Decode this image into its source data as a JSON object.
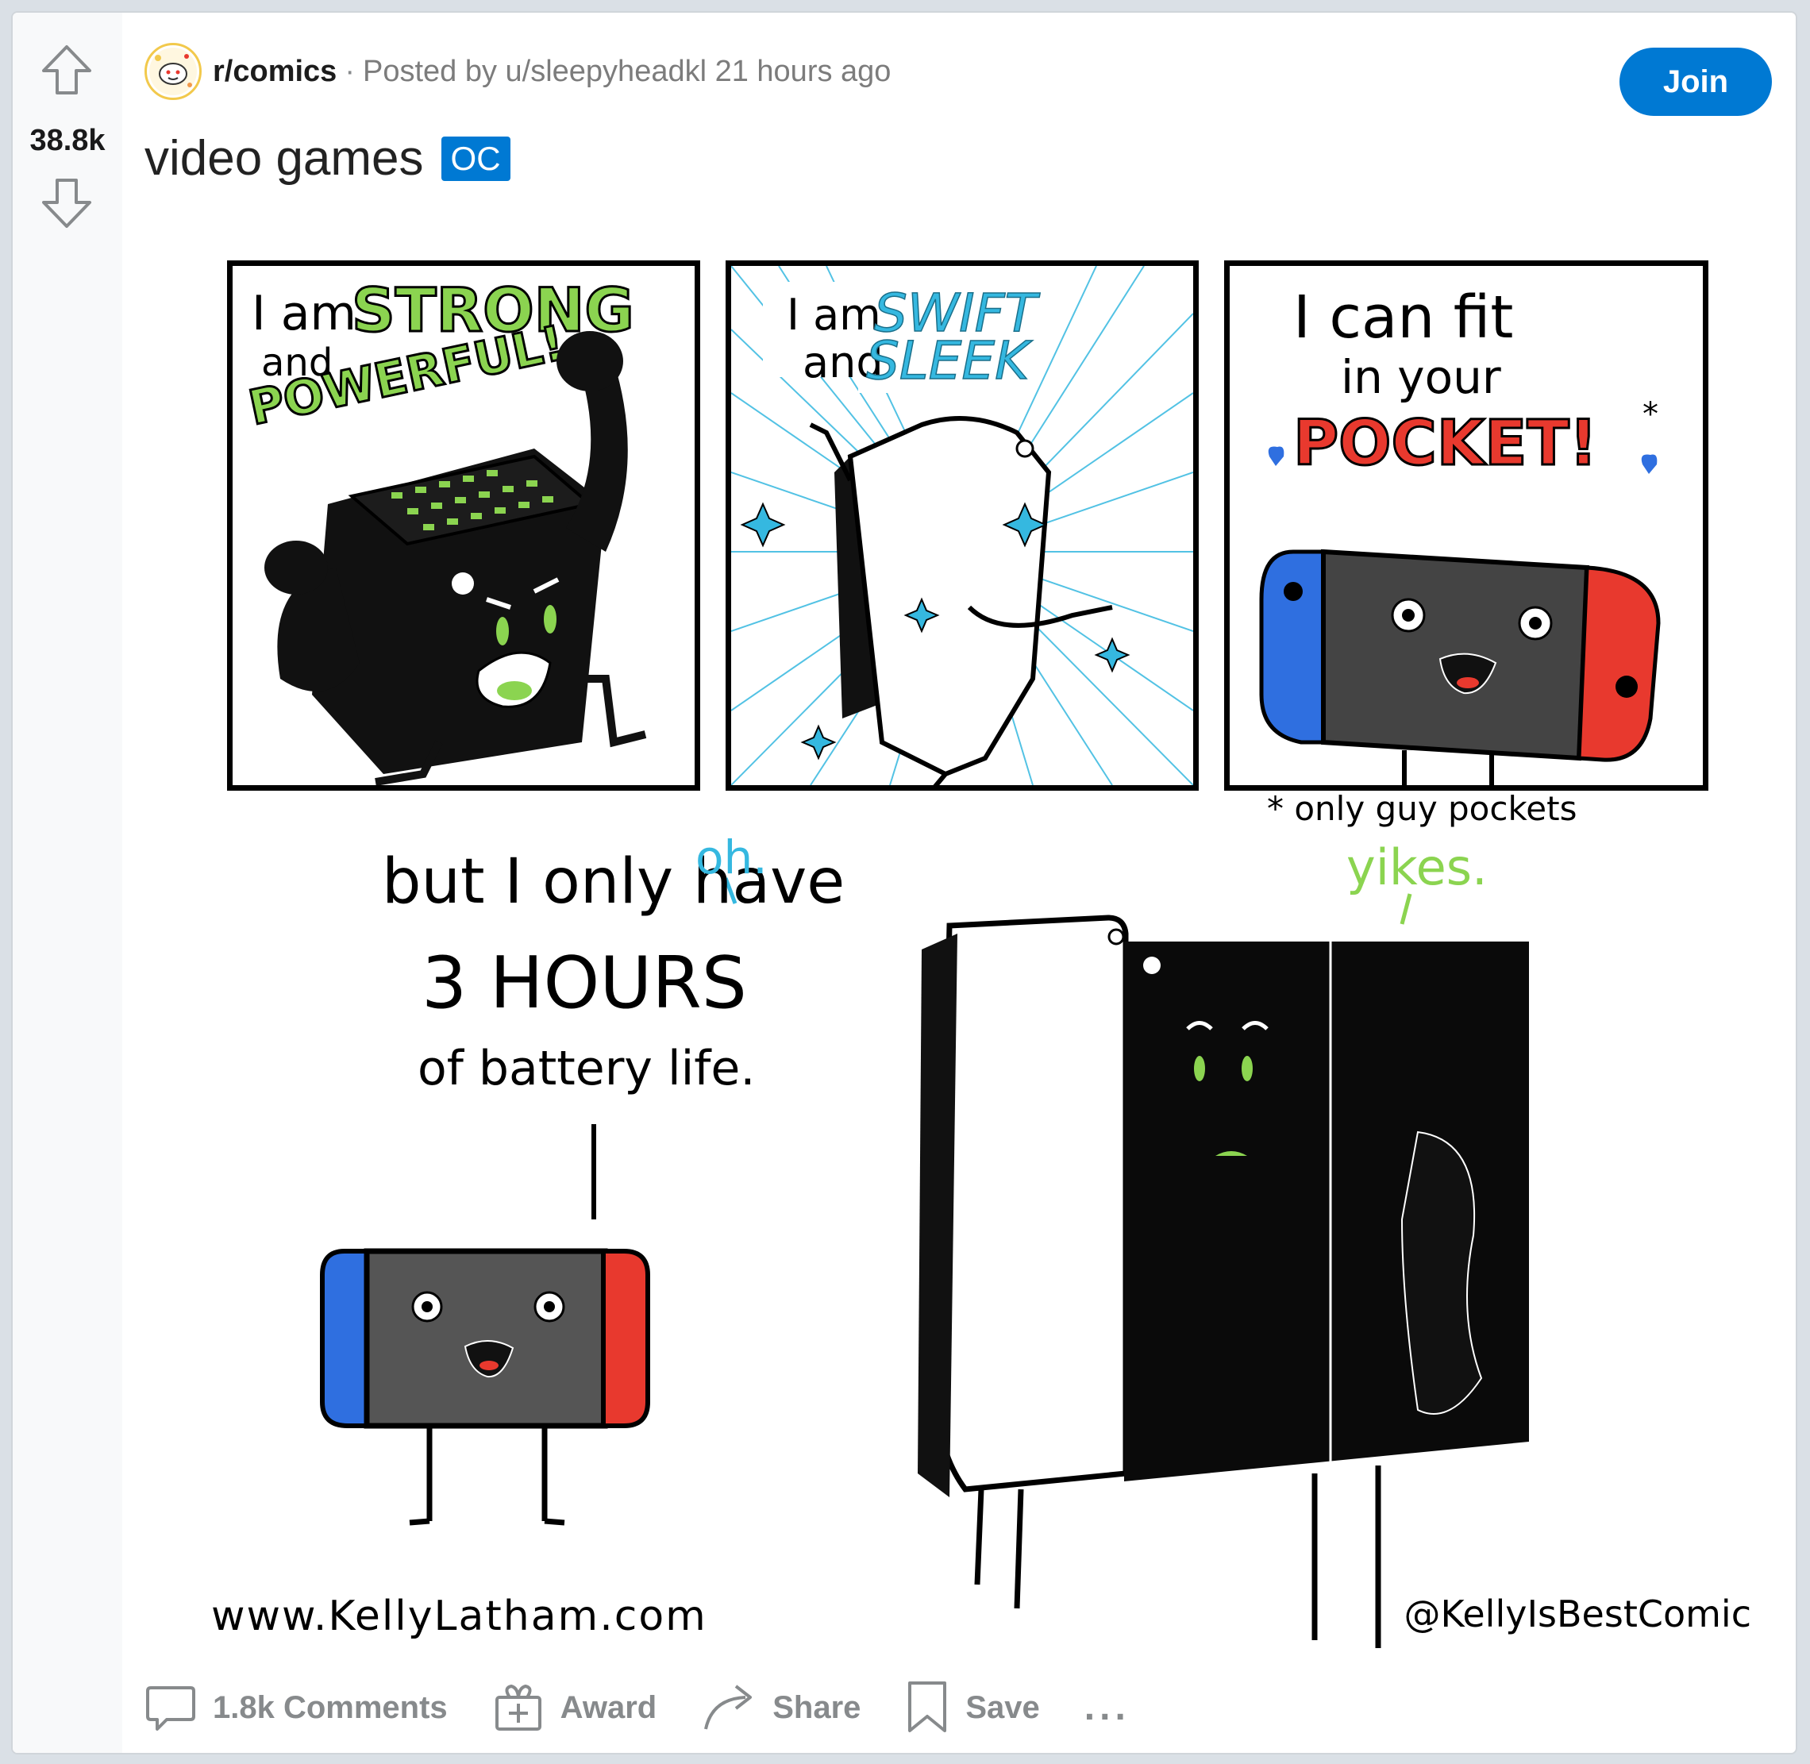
{
  "vote": {
    "count": "38.8k",
    "upvote_icon": "arrow-up-outline",
    "downvote_icon": "arrow-down-outline"
  },
  "header": {
    "subreddit": "r/comics",
    "separator": "·",
    "posted_by": "Posted by u/sleepyheadkl 21 hours ago",
    "join_label": "Join"
  },
  "post": {
    "title": "video games",
    "flair": "OC"
  },
  "comic": {
    "panel1": {
      "line1": "I am",
      "line1_big": "STRONG",
      "line2": "and",
      "line3": "POWERFUL!"
    },
    "panel2": {
      "line1": "I am",
      "line1_big": "SWIFT",
      "line2": "and",
      "line2_big": "SLEEK"
    },
    "panel3": {
      "line1": "I can fit",
      "line2": "in your",
      "line3": "POCKET!",
      "star": "*"
    },
    "footnote": "* only guy pockets",
    "bottom": {
      "speech1": "but I only have",
      "speech2": "3 HOURS",
      "speech3": "of battery life.",
      "reaction_left": "oh.",
      "reaction_right": "yikes."
    },
    "credit_left": "www.KellyLatham.com",
    "credit_right": "@KellyIsBestComic"
  },
  "actions": {
    "comments": "1.8k Comments",
    "award": "Award",
    "share": "Share",
    "save": "Save",
    "more": "..."
  },
  "colors": {
    "accent": "#0079d3",
    "xbox_green": "#8bd450",
    "ps_blue": "#35b8e0",
    "joycon_blue": "#2f6fe0",
    "joycon_red": "#e8392e"
  }
}
